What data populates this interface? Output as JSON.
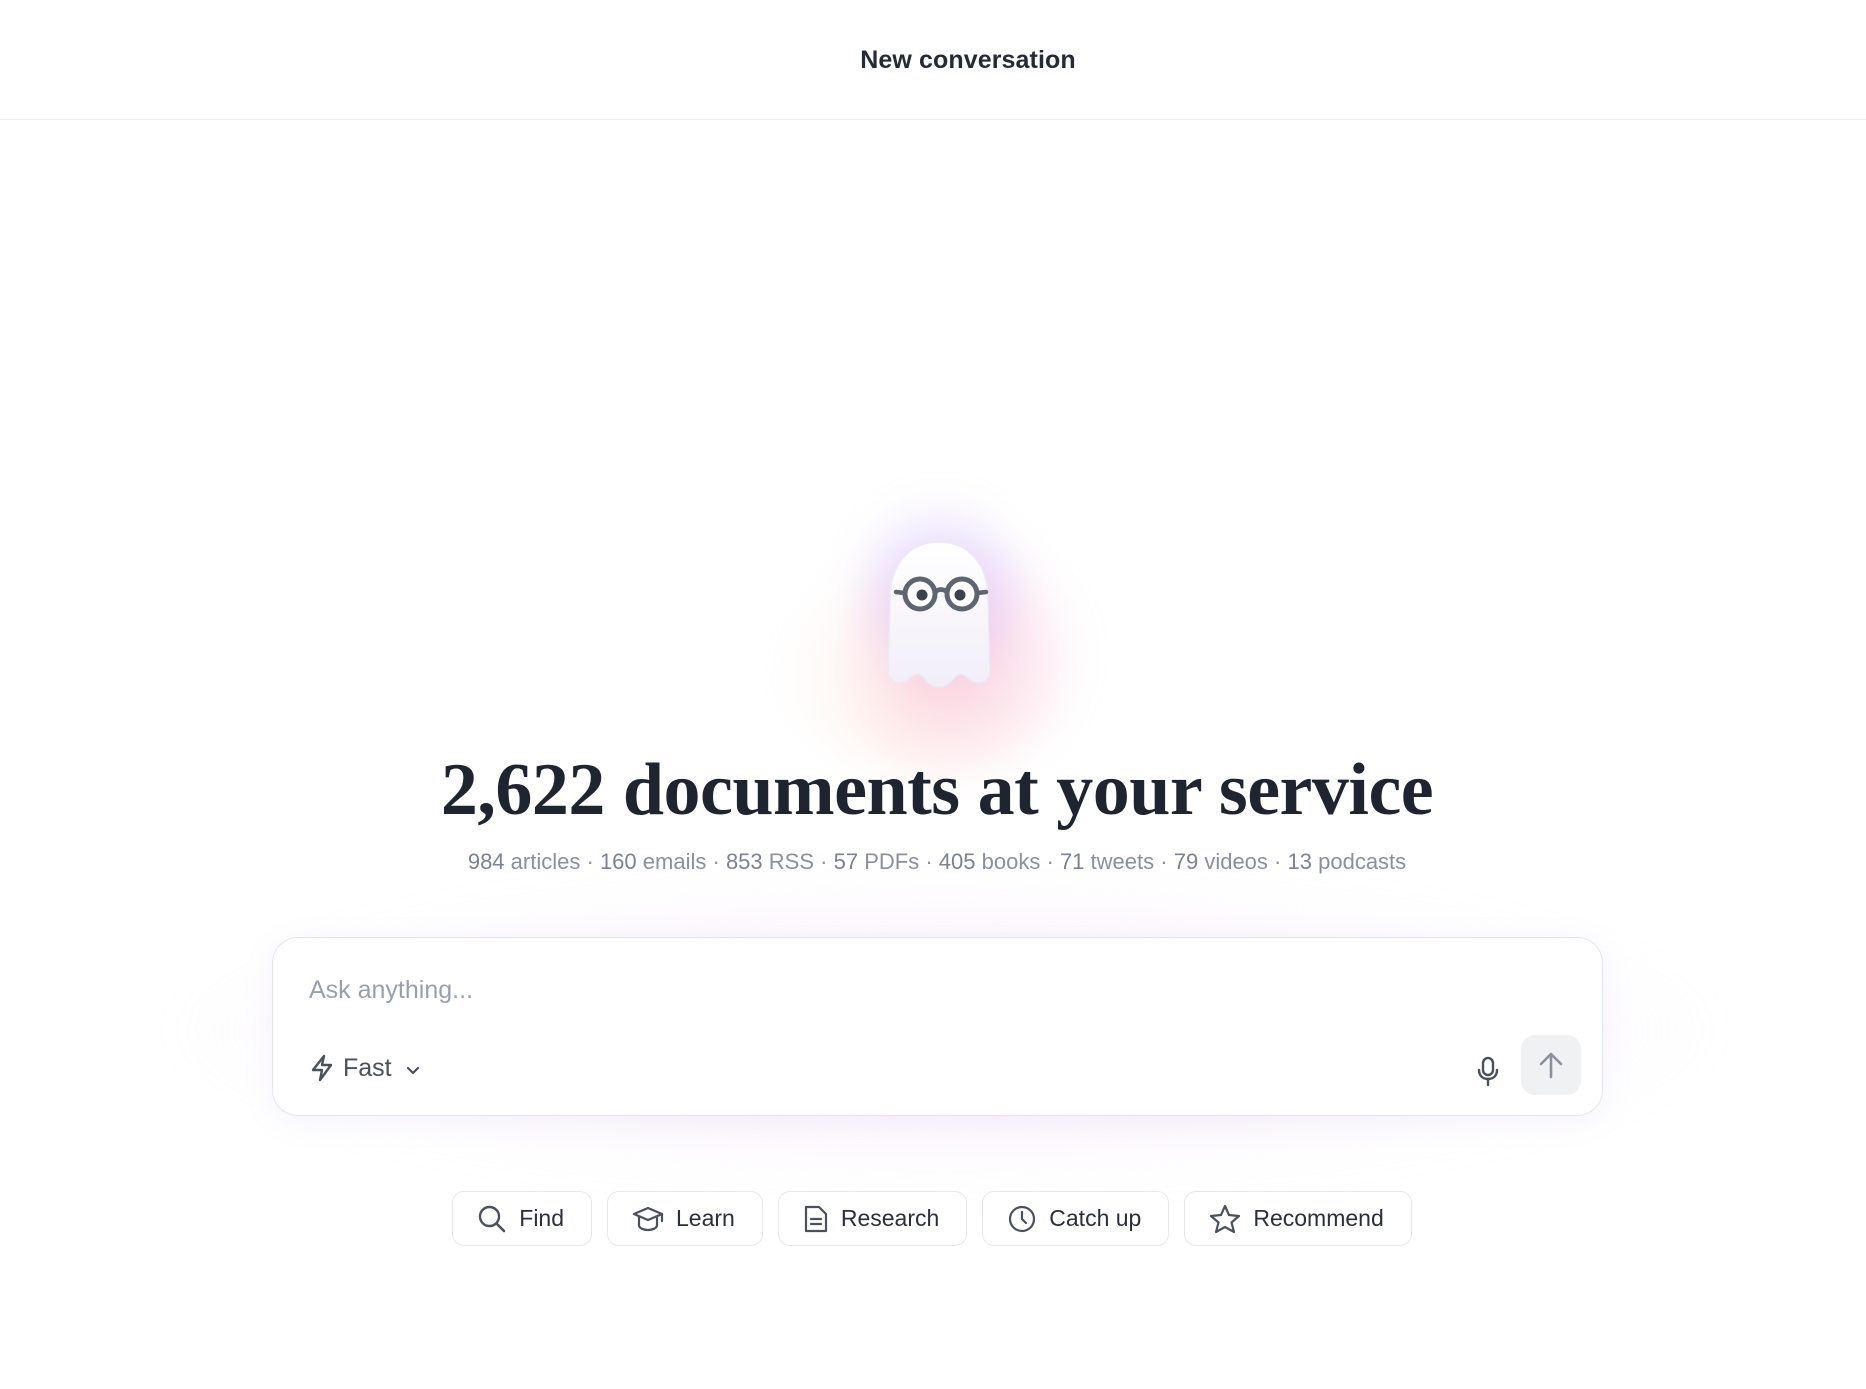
{
  "header": {
    "title": "New conversation"
  },
  "hero": {
    "headline": "2,622 documents at your service",
    "stats": [
      {
        "count": "984",
        "label": "articles"
      },
      {
        "count": "160",
        "label": "emails"
      },
      {
        "count": "853",
        "label": "RSS"
      },
      {
        "count": "57",
        "label": "PDFs"
      },
      {
        "count": "405",
        "label": "books"
      },
      {
        "count": "71",
        "label": "tweets"
      },
      {
        "count": "79",
        "label": "videos"
      },
      {
        "count": "13",
        "label": "podcasts"
      }
    ],
    "separator": "·"
  },
  "composer": {
    "placeholder": "Ask anything...",
    "value": "",
    "mode_label": "Fast",
    "mode_icon": "lightning-icon",
    "mic_icon": "microphone-icon",
    "send_icon": "arrow-up-icon"
  },
  "suggestions": [
    {
      "label": "Find",
      "icon": "search-icon"
    },
    {
      "label": "Learn",
      "icon": "graduation-cap-icon"
    },
    {
      "label": "Research",
      "icon": "document-icon"
    },
    {
      "label": "Catch up",
      "icon": "clock-icon"
    },
    {
      "label": "Recommend",
      "icon": "star-icon"
    }
  ],
  "colors": {
    "headline": "#1f2530",
    "muted_text": "#8a909c",
    "border": "#e4e6eb",
    "send_bg": "#f0f1f3",
    "glow_purple": "#bea0ff",
    "glow_pink": "#f5aad7"
  }
}
